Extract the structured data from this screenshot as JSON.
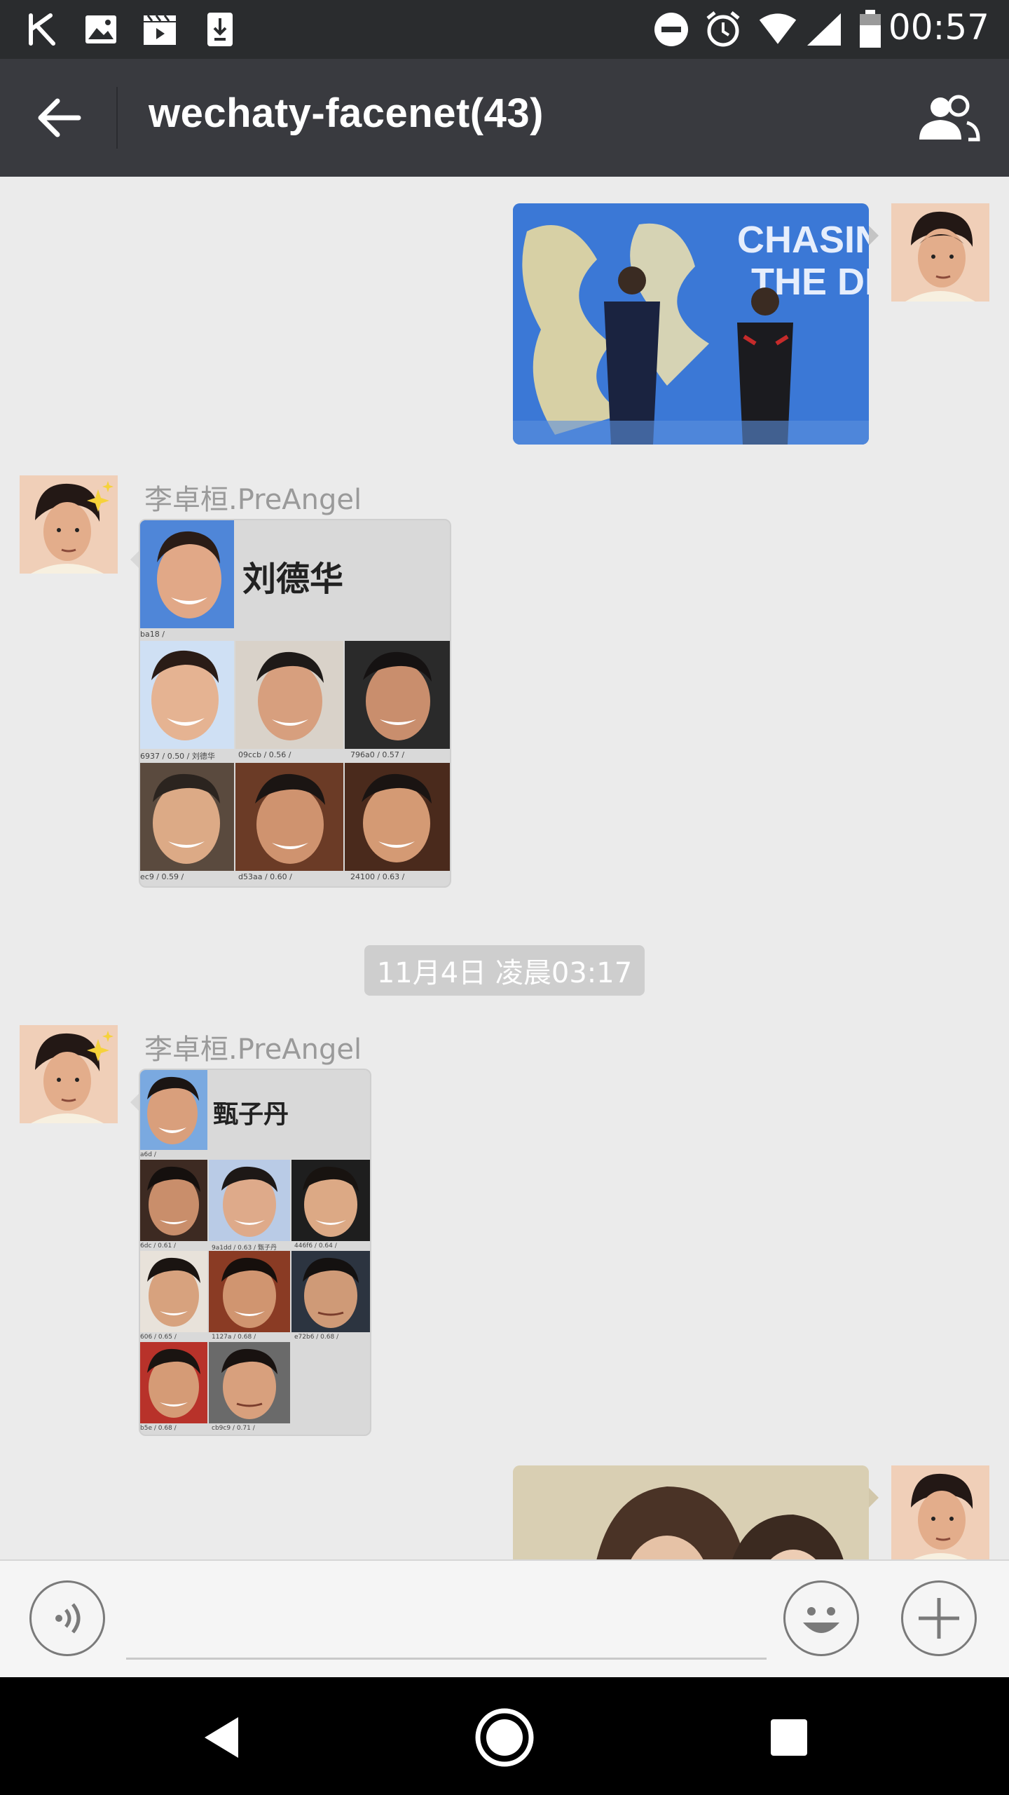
{
  "status_bar": {
    "time": "00:57",
    "left_icons": [
      "k-app-icon",
      "image-icon",
      "clapper-icon",
      "download-icon"
    ],
    "right_icons": [
      "do-not-disturb-icon",
      "alarm-icon",
      "wifi-icon",
      "signal-icon",
      "battery-icon"
    ]
  },
  "app_bar": {
    "title": "wechaty-facenet(43)",
    "back_icon": "arrow-left-icon",
    "members_icon": "group-members-icon"
  },
  "messages": [
    {
      "type": "image",
      "direction": "outgoing",
      "description_icon": "photo"
    },
    {
      "type": "face-grid",
      "direction": "incoming",
      "sender": "李卓桓.PreAngel",
      "title": "刘德华",
      "captions": [
        "ba18 /",
        "6937 / 0.50 / 刘德华",
        "09ccb / 0.56 /",
        "796a0 / 0.57 /",
        "ec9 / 0.59 /",
        "d53aa / 0.60 /",
        "24100 / 0.63 /"
      ]
    },
    {
      "type": "timestamp",
      "text": "11月4日 凌晨03:17"
    },
    {
      "type": "face-grid",
      "direction": "incoming",
      "sender": "李卓桓.PreAngel",
      "title": "甄子丹",
      "captions": [
        "a6d /",
        "6dc / 0.61 /",
        "9a1dd / 0.63 / 甄子丹",
        "446f6 / 0.64 /",
        "606 / 0.65 /",
        "1127a / 0.68 /",
        "e72b6 / 0.68 /",
        "b5e / 0.68 /",
        "cb9c9 / 0.71 /"
      ]
    },
    {
      "type": "image",
      "direction": "outgoing"
    }
  ],
  "input_bar": {
    "voice_icon": "voice-icon",
    "emoji_icon": "emoji-icon",
    "plus_icon": "plus-icon",
    "placeholder": ""
  },
  "nav_bar": {
    "icons": [
      "back-triangle-icon",
      "home-circle-icon",
      "recents-square-icon"
    ]
  },
  "colors": {
    "status_bar": "#2a2c2e",
    "app_bar": "#393a3f",
    "chat_bg": "#ebebeb",
    "timestamp_bg": "#cecece"
  }
}
